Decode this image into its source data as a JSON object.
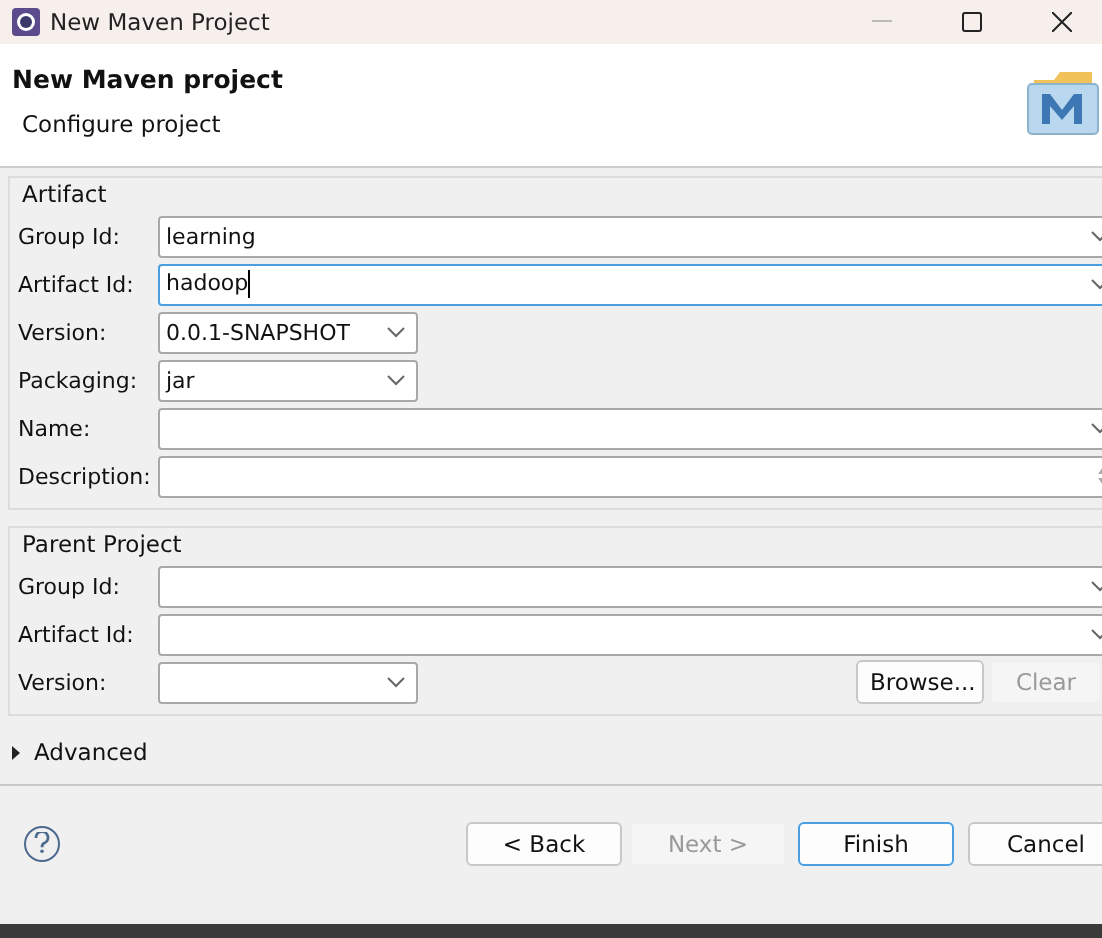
{
  "window": {
    "title": "New Maven Project"
  },
  "header": {
    "title": "New Maven project",
    "subtitle": "Configure project"
  },
  "groups": [
    {
      "title": "Artifact",
      "fields": [
        {
          "label": "Group Id:",
          "kind": "combo",
          "value": "learning",
          "focused": false
        },
        {
          "label": "Artifact Id:",
          "kind": "combo",
          "value": "hadoop",
          "focused": true
        },
        {
          "label": "Version:",
          "kind": "dropdown",
          "value": "0.0.1-SNAPSHOT",
          "focused": false
        },
        {
          "label": "Packaging:",
          "kind": "dropdown",
          "value": "jar",
          "focused": false
        },
        {
          "label": "Name:",
          "kind": "combo",
          "focused": false
        },
        {
          "label": "Description:",
          "kind": "textarea",
          "focused": false
        }
      ]
    },
    {
      "title": "Parent Project",
      "fields": [
        {
          "label": "Group Id:",
          "kind": "combo",
          "focused": false
        },
        {
          "label": "Artifact Id:",
          "kind": "combo",
          "focused": false
        },
        {
          "label": "Version:",
          "kind": "dropdown",
          "focused": false,
          "buttons": [
            {
              "label": "Browse...",
              "disabled": false
            },
            {
              "label": "Clear",
              "disabled": true
            }
          ]
        }
      ]
    }
  ],
  "advanced": {
    "label": "Advanced",
    "expanded": false
  },
  "buttons": [
    {
      "label": "< Back",
      "disabled": false,
      "default": false
    },
    {
      "label": "Next >",
      "disabled": true,
      "default": false
    },
    {
      "label": "Finish",
      "disabled": false,
      "default": true
    },
    {
      "label": "Cancel",
      "disabled": false,
      "default": false
    }
  ]
}
